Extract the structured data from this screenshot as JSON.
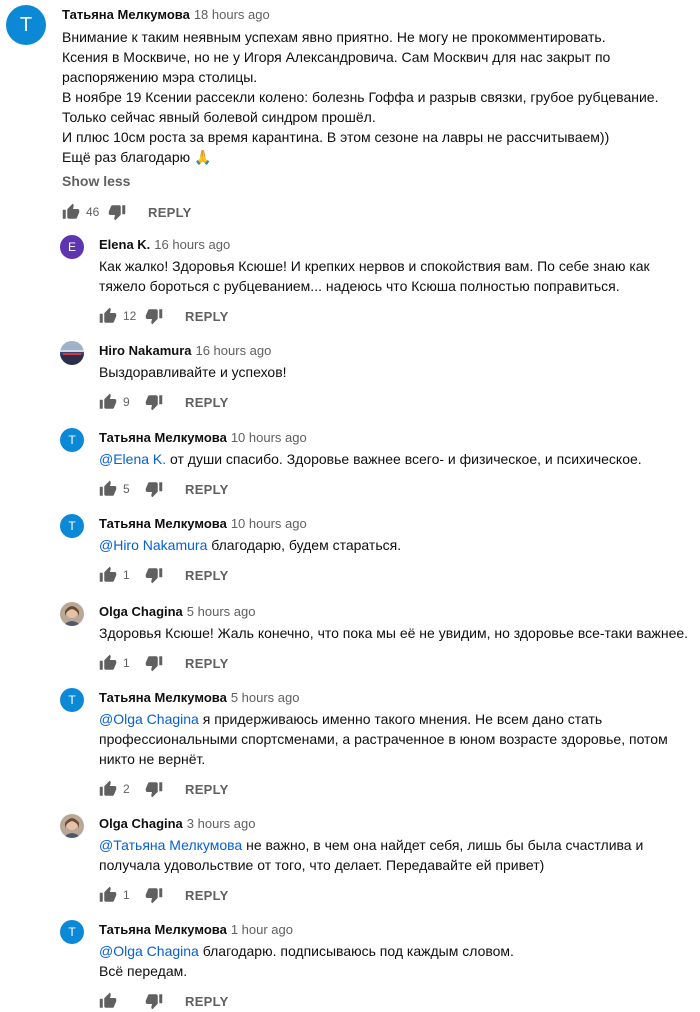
{
  "comments": [
    {
      "author": "Татьяна Мелкумова",
      "time": "18 hours ago",
      "avatar_letter": "T",
      "avatar_color": "#0b88d6",
      "lines": [
        "Внимание к таким неявным успехам явно приятно. Не могу не прокомментировать.",
        "Ксения в Москвиче, но не у Игоря Александровича. Сам Москвич для нас закрыт по",
        "распоряжению мэра столицы.",
        "В ноябре 19 Ксении рассекли колено: болезнь Гоффа и разрыв связки, грубое рубцевание.",
        "Только сейчас явный болевой синдром прошёл.",
        "И плюс 10см роста за время карантина. В этом сезоне на лавры не рассчитываем))",
        "Ещё раз благодарю 🙏"
      ],
      "show_less": "Show less",
      "likes": "46",
      "reply": "REPLY"
    },
    {
      "author": "Elena K.",
      "time": "16 hours ago",
      "avatar_letter": "E",
      "avatar_color": "#5e35b1",
      "lines": [
        "Как жалко! Здоровья Ксюше! И крепких нервов и спокойствия вам. По себе знаю как",
        "тяжело бороться с рубцеванием... надеюсь что Ксюша полностью поправиться."
      ],
      "likes": "12",
      "reply": "REPLY"
    },
    {
      "author": "Hiro Nakamura",
      "time": "16 hours ago",
      "avatar_icon": "photo-avatar-icon",
      "lines": [
        "Выздоравливайте и успехов!"
      ],
      "likes": "9",
      "reply": "REPLY"
    },
    {
      "author": "Татьяна Мелкумова",
      "time": "10 hours ago",
      "avatar_letter": "T",
      "avatar_color": "#0b88d6",
      "mention": "@Elena K.",
      "lines": [
        " от души спасибо. Здоровье важнее всего- и физическое, и психическое."
      ],
      "likes": "5",
      "reply": "REPLY"
    },
    {
      "author": "Татьяна Мелкумова",
      "time": "10 hours ago",
      "avatar_letter": "T",
      "avatar_color": "#0b88d6",
      "mention": "@Hiro Nakamura",
      "lines": [
        " благодарю, будем стараться."
      ],
      "likes": "1",
      "reply": "REPLY"
    },
    {
      "author": "Olga Chagina",
      "time": "5 hours ago",
      "avatar_icon": "photo-avatar-icon",
      "lines": [
        "Здоровья Ксюше! Жаль конечно, что пока мы её не увидим, но здоровье все-таки важнее."
      ],
      "likes": "1",
      "reply": "REPLY"
    },
    {
      "author": "Татьяна Мелкумова",
      "time": "5 hours ago",
      "avatar_letter": "T",
      "avatar_color": "#0b88d6",
      "mention": "@Olga Chagina",
      "lines": [
        " я придерживаюсь именно такого мнения. Не всем дано стать",
        "профессиональными спортсменами, а растраченное в юном возрасте здоровье, потом",
        "никто не вернёт."
      ],
      "likes": "2",
      "reply": "REPLY"
    },
    {
      "author": "Olga Chagina",
      "time": "3 hours ago",
      "avatar_icon": "photo-avatar-icon",
      "mention": "@Татьяна Мелкумова",
      "lines": [
        " не важно, в чем она найдет себя, лишь бы была счастлива и",
        "получала удовольствие от того, что делает. Передавайте ей привет)"
      ],
      "likes": "1",
      "reply": "REPLY"
    },
    {
      "author": "Татьяна Мелкумова",
      "time": "1 hour ago",
      "avatar_letter": "T",
      "avatar_color": "#0b88d6",
      "mention": "@Olga Chagina",
      "lines": [
        " благодарю. подписываюсь под каждым словом.",
        "Всё передам."
      ],
      "likes": "",
      "reply": "REPLY"
    }
  ]
}
